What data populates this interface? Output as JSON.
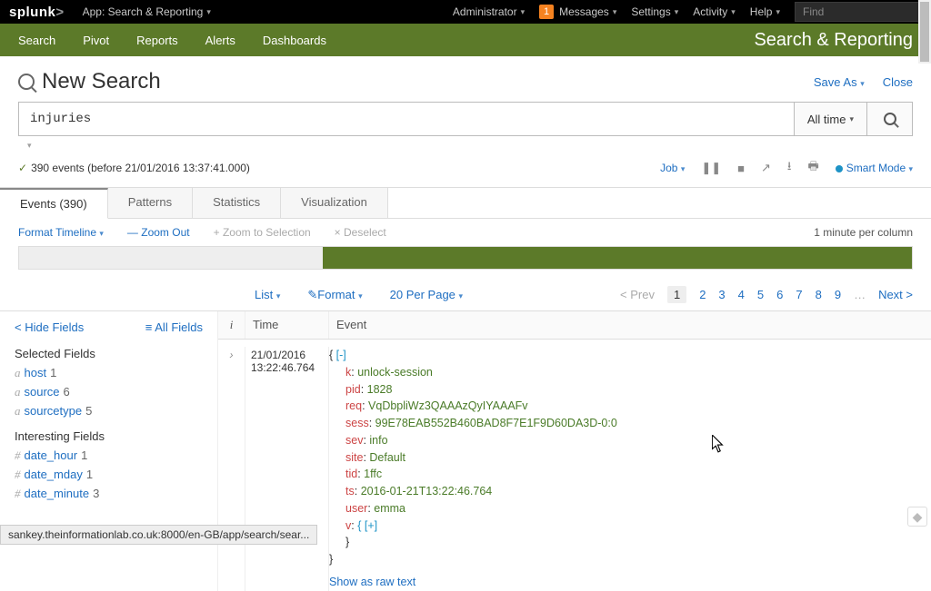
{
  "logo": {
    "text": "splunk",
    "suffix": ">"
  },
  "appMenu": "App: Search & Reporting",
  "top": {
    "admin": "Administrator",
    "messages": "Messages",
    "msg_count": "1",
    "settings": "Settings",
    "activity": "Activity",
    "help": "Help",
    "find_placeholder": "Find"
  },
  "nav": {
    "search": "Search",
    "pivot": "Pivot",
    "reports": "Reports",
    "alerts": "Alerts",
    "dashboards": "Dashboards"
  },
  "appTitle": "Search & Reporting",
  "pageTitle": "New Search",
  "titleActions": {
    "saveas": "Save As",
    "close": "Close"
  },
  "search": {
    "query": "injuries",
    "range": "All time"
  },
  "status_line": "390 events (before 21/01/2016 13:37:41.000)",
  "toolbar": {
    "job": "Job",
    "smart": "Smart Mode"
  },
  "tabs": {
    "events": "Events (390)",
    "patterns": "Patterns",
    "stats": "Statistics",
    "viz": "Visualization"
  },
  "timeline": {
    "format": "Format Timeline",
    "zoomout": "Zoom Out",
    "zoomsel": "+ Zoom to Selection",
    "deselect": "× Deselect",
    "right": "1 minute per column"
  },
  "listbar": {
    "list": "List",
    "format": "Format",
    "perpage": "20 Per Page",
    "prev": "< Prev",
    "next": "Next >",
    "pages": [
      "1",
      "2",
      "3",
      "4",
      "5",
      "6",
      "7",
      "8",
      "9",
      "…"
    ]
  },
  "fields": {
    "hide": "< Hide Fields",
    "all": "≡ All Fields",
    "selected_hdr": "Selected Fields",
    "sel": [
      {
        "p": "a",
        "n": "host",
        "c": "1"
      },
      {
        "p": "a",
        "n": "source",
        "c": "6"
      },
      {
        "p": "a",
        "n": "sourcetype",
        "c": "5"
      }
    ],
    "interesting_hdr": "Interesting Fields",
    "intr": [
      {
        "p": "#",
        "n": "date_hour",
        "c": "1"
      },
      {
        "p": "#",
        "n": "date_mday",
        "c": "1"
      },
      {
        "p": "#",
        "n": "date_minute",
        "c": "3"
      }
    ]
  },
  "etable": {
    "col_i": "i",
    "col_time": "Time",
    "col_event": "Event"
  },
  "event": {
    "time_date": "21/01/2016",
    "time_time": "13:22:46.764",
    "kv": [
      {
        "k": "k",
        "v": "unlock-session"
      },
      {
        "k": "pid",
        "v": "1828"
      },
      {
        "k": "req",
        "v": "VqDbpliWz3QAAAzQyIYAAAFv"
      },
      {
        "k": "sess",
        "v": "99E78EAB552B460BAD8F7E1F9D60DA3D-0:0"
      },
      {
        "k": "sev",
        "v": "info"
      },
      {
        "k": "site",
        "v": "Default"
      },
      {
        "k": "tid",
        "v": "1ffc"
      },
      {
        "k": "ts",
        "v": "2016-01-21T13:22:46.764"
      },
      {
        "k": "user",
        "v": "emma"
      }
    ],
    "v_label": "v",
    "v_inner": "{ [+]",
    "showraw": "Show as raw text",
    "collapse": "[-]"
  },
  "status_url": "sankey.theinformationlab.co.uk:8000/en-GB/app/search/sear...",
  "chart_data": {
    "type": "bar",
    "note": "event timeline histogram, unlabeled",
    "bars": [
      {
        "start_frac": 0.34,
        "width_frac": 0.33,
        "height": 1.0
      },
      {
        "start_frac": 0.67,
        "width_frac": 0.33,
        "height": 1.0
      }
    ]
  }
}
